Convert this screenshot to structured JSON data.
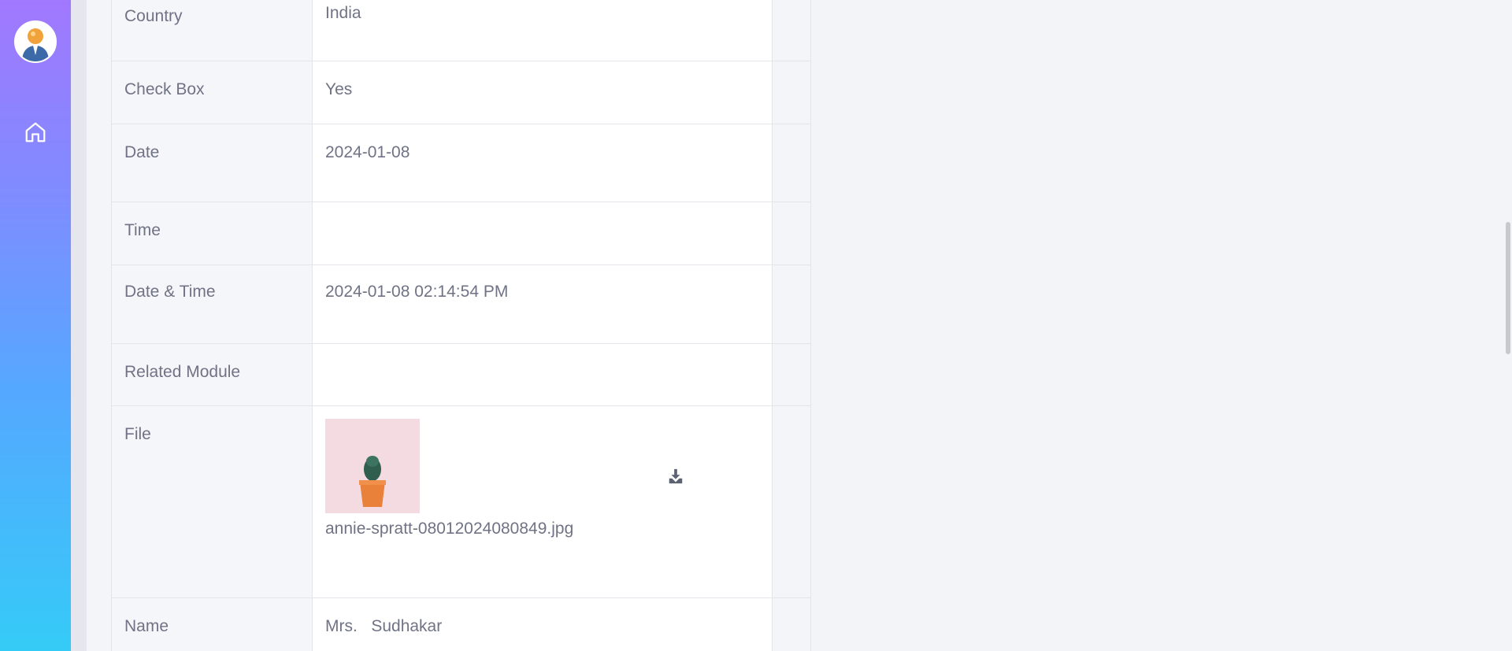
{
  "sidebar": {
    "avatar_icon": "user-avatar-icon",
    "home_icon": "home-icon"
  },
  "details": {
    "rows": [
      {
        "label": "Country",
        "value": "India"
      },
      {
        "label": "Check Box",
        "value": "Yes"
      },
      {
        "label": "Date",
        "value": "2024-01-08"
      },
      {
        "label": "Time",
        "value": ""
      },
      {
        "label": "Date & Time",
        "value": "2024-01-08 02:14:54 PM"
      },
      {
        "label": "Related Module",
        "value": ""
      },
      {
        "label": "File",
        "value": "annie-spratt-08012024080849.jpg"
      },
      {
        "label": "Name",
        "value": "Mrs.   Sudhakar"
      }
    ],
    "download_icon": "download-icon"
  },
  "colors": {
    "sidebar_top": "#a178ff",
    "sidebar_bottom": "#35cbf7",
    "text": "#6f7385"
  }
}
